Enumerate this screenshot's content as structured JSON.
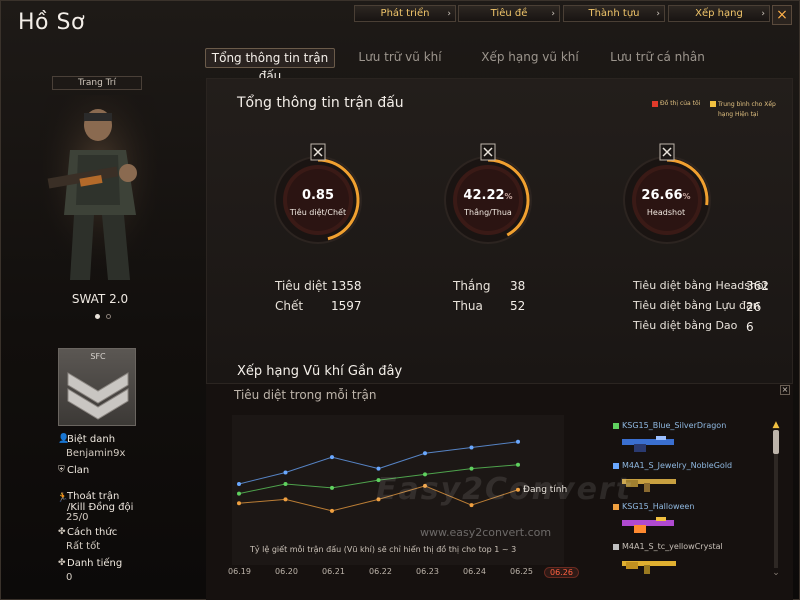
{
  "window": {
    "title": "Hồ Sơ"
  },
  "top_tabs": [
    {
      "label": "Phát triển"
    },
    {
      "label": "Tiêu đề"
    },
    {
      "label": "Thành tựu"
    },
    {
      "label": "Xếp hạng"
    }
  ],
  "close_label": "×",
  "sub_tabs": [
    {
      "label": "Tổng thông tin trận đấu",
      "active": true
    },
    {
      "label": "Lưu trữ vũ khí"
    },
    {
      "label": "Xếp hạng vũ khí"
    },
    {
      "label": "Lưu trữ cá nhân"
    }
  ],
  "profile": {
    "decorate_label": "Trang Trí",
    "character_name": "SWAT 2.0",
    "rank_badge": "SFC",
    "nickname_label": "Biệt danh",
    "nickname": "Benjamin9x",
    "clan_label": "Clan",
    "escape_label": "Thoát trận",
    "teamkill_label": "/Kill Đồng đội",
    "escape_value": "25/0",
    "style_label": "Cách thức",
    "style_value": "Rất tốt",
    "fame_label": "Danh tiếng",
    "fame_value": "0"
  },
  "stats": {
    "title": "Tổng thông tin trận đấu",
    "legend_mine": "Đồ thị của tôi",
    "legend_avg": "Trung bình cho Xếp hạng Hiện tại",
    "gauges": [
      {
        "value": "0.85",
        "label": "Tiêu diệt/Chết",
        "fraction": 0.46,
        "icon": "skull-icon"
      },
      {
        "value": "42.22",
        "unit": "%",
        "label": "Thắng/Thua",
        "fraction": 0.42,
        "icon": "crossed-swords-icon"
      },
      {
        "value": "26.66",
        "unit": "%",
        "label": "Headshot",
        "fraction": 0.27,
        "icon": "knife-icon"
      }
    ],
    "col1": [
      {
        "label": "Tiêu diệt",
        "value": "1358"
      },
      {
        "label": "Chết",
        "value": "1597"
      }
    ],
    "col2": [
      {
        "label": "Thắng",
        "value": "38"
      },
      {
        "label": "Thua",
        "value": "52"
      }
    ],
    "col3": [
      {
        "label": "Tiêu diệt bằng Headshot",
        "value": "362"
      },
      {
        "label": "Tiêu diệt bằng Lựu đạn",
        "value": "26"
      },
      {
        "label": "Tiêu diệt bằng Dao",
        "value": "6"
      }
    ]
  },
  "weapons": {
    "title": "Xếp hạng Vũ khí Gần đây",
    "subtitle": "Tiêu diệt trong mỗi trận",
    "loading": "Đang tính",
    "note": "Tỷ lệ giết mỗi trận đấu (Vũ khí) sẽ chỉ hiển thị đồ thị cho top 1 ~ 3",
    "dates": [
      "06.19",
      "06.20",
      "06.21",
      "06.22",
      "06.23",
      "06.24",
      "06.25",
      "06.26"
    ],
    "active_date": "06.26",
    "list": [
      {
        "name": "KSG15_Blue_SilverDragon",
        "color": "#5fd15f"
      },
      {
        "name": "M4A1_S_Jewelry_NobleGold",
        "color": "#6aa8ff"
      },
      {
        "name": "KSG15_Halloween",
        "color": "#f0a040"
      },
      {
        "name": "M4A1_S_tc_yellowCrystal",
        "color": "#c0c0c0"
      }
    ],
    "watermark": "Easy2Convert",
    "watermark_url": "www.easy2convert.com"
  },
  "chart_data": {
    "type": "line",
    "title": "Tiêu diệt trong mỗi trận",
    "categories": [
      "06.19",
      "06.20",
      "06.21",
      "06.22",
      "06.23",
      "06.24",
      "06.25",
      "06.26"
    ],
    "series": [
      {
        "name": "KSG15_Blue_SilverDragon",
        "color": "#5fd15f",
        "values": [
          4.5,
          5.0,
          4.8,
          5.2,
          5.5,
          5.8,
          6.0,
          null
        ]
      },
      {
        "name": "M4A1_S_Jewelry_NobleGold",
        "color": "#6aa8ff",
        "values": [
          5.0,
          5.6,
          6.4,
          5.8,
          6.6,
          6.9,
          7.2,
          null
        ]
      },
      {
        "name": "KSG15_Halloween",
        "color": "#f0a040",
        "values": [
          4.0,
          4.2,
          3.6,
          4.2,
          4.9,
          3.9,
          4.7,
          null
        ]
      }
    ],
    "ylim": [
      0,
      10
    ]
  }
}
